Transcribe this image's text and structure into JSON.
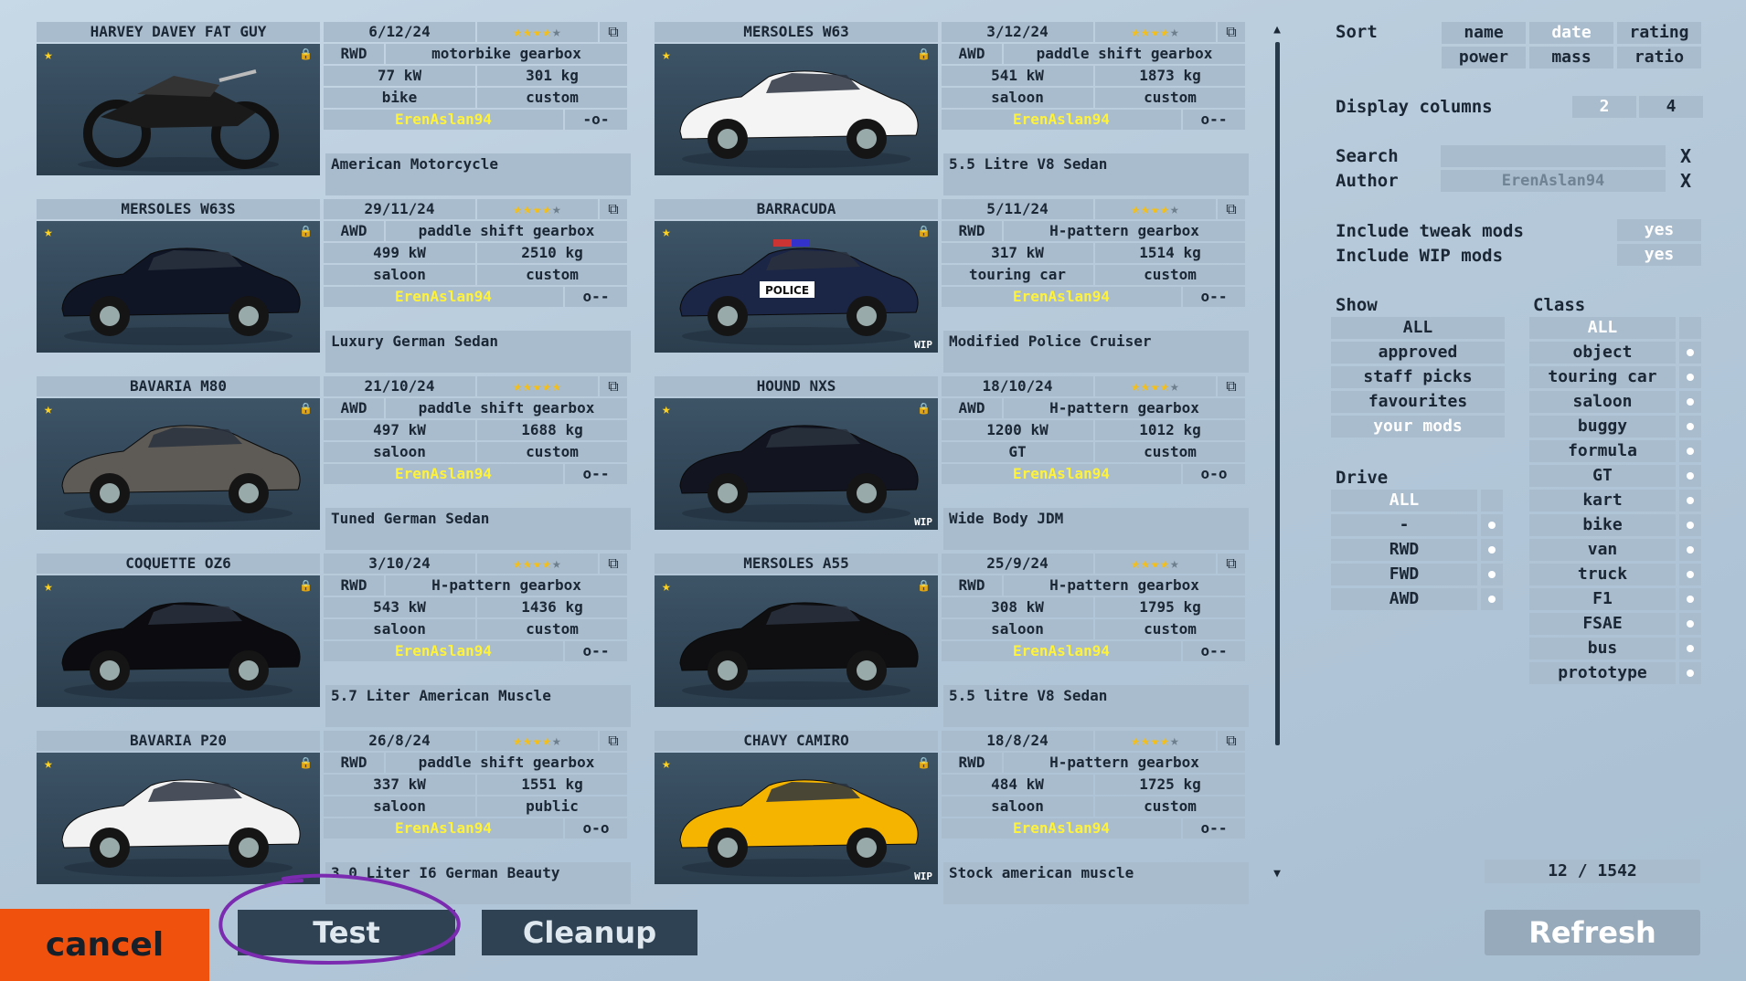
{
  "cards": [
    {
      "name": "HARVEY DAVEY FAT GUY",
      "date": "6/12/24",
      "stars": "★★★★",
      "stars_off": "★",
      "drive": "RWD",
      "gearbox": "motorbike gearbox",
      "power": "77 kW",
      "mass": "301 kg",
      "type": "bike",
      "license": "custom",
      "author": "ErenAslan94",
      "layout": "-o-",
      "desc": "American Motorcycle",
      "wip": ""
    },
    {
      "name": "MERSOLES W63",
      "date": "3/12/24",
      "stars": "★★★★",
      "stars_off": "★",
      "drive": "AWD",
      "gearbox": "paddle shift gearbox",
      "power": "541 kW",
      "mass": "1873 kg",
      "type": "saloon",
      "license": "custom",
      "author": "ErenAslan94",
      "layout": "o--",
      "desc": "5.5 Litre V8 Sedan",
      "wip": ""
    },
    {
      "name": "MERSOLES W63S",
      "date": "29/11/24",
      "stars": "★★★★",
      "stars_off": "★",
      "drive": "AWD",
      "gearbox": "paddle shift gearbox",
      "power": "499 kW",
      "mass": "2510 kg",
      "type": "saloon",
      "license": "custom",
      "author": "ErenAslan94",
      "layout": "o--",
      "desc": "Luxury German Sedan",
      "wip": ""
    },
    {
      "name": "BARRACUDA",
      "date": "5/11/24",
      "stars": "★★★★",
      "stars_off": "★",
      "drive": "RWD",
      "gearbox": "H-pattern gearbox",
      "power": "317 kW",
      "mass": "1514 kg",
      "type": "touring car",
      "license": "custom",
      "author": "ErenAslan94",
      "layout": "o--",
      "desc": "Modified Police Cruiser",
      "wip": "WIP"
    },
    {
      "name": "BAVARIA M80",
      "date": "21/10/24",
      "stars": "★★★★★",
      "stars_off": "",
      "drive": "AWD",
      "gearbox": "paddle shift gearbox",
      "power": "497 kW",
      "mass": "1688 kg",
      "type": "saloon",
      "license": "custom",
      "author": "ErenAslan94",
      "layout": "o--",
      "desc": "Tuned German Sedan",
      "wip": ""
    },
    {
      "name": "HOUND NXS",
      "date": "18/10/24",
      "stars": "★★★★",
      "stars_off": "★",
      "drive": "AWD",
      "gearbox": "H-pattern gearbox",
      "power": "1200 kW",
      "mass": "1012 kg",
      "type": "GT",
      "license": "custom",
      "author": "ErenAslan94",
      "layout": "o-o",
      "desc": "Wide Body JDM",
      "wip": "WIP"
    },
    {
      "name": "COQUETTE OZ6",
      "date": "3/10/24",
      "stars": "★★★★",
      "stars_off": "★",
      "drive": "RWD",
      "gearbox": "H-pattern gearbox",
      "power": "543 kW",
      "mass": "1436 kg",
      "type": "saloon",
      "license": "custom",
      "author": "ErenAslan94",
      "layout": "o--",
      "desc": "5.7 Liter American Muscle",
      "wip": ""
    },
    {
      "name": "MERSOLES A55",
      "date": "25/9/24",
      "stars": "★★★★",
      "stars_off": "★",
      "drive": "RWD",
      "gearbox": "H-pattern gearbox",
      "power": "308 kW",
      "mass": "1795 kg",
      "type": "saloon",
      "license": "custom",
      "author": "ErenAslan94",
      "layout": "o--",
      "desc": "5.5 litre V8 Sedan",
      "wip": ""
    },
    {
      "name": "BAVARIA P20",
      "date": "26/8/24",
      "stars": "★★★★",
      "stars_off": "★",
      "drive": "RWD",
      "gearbox": "paddle shift gearbox",
      "power": "337 kW",
      "mass": "1551 kg",
      "type": "saloon",
      "license": "public",
      "author": "ErenAslan94",
      "layout": "o-o",
      "desc": "3.0 Liter I6 German Beauty",
      "wip": ""
    },
    {
      "name": "CHAVY CAMIRO",
      "date": "18/8/24",
      "stars": "★★★★",
      "stars_off": "★",
      "drive": "RWD",
      "gearbox": "H-pattern gearbox",
      "power": "484 kW",
      "mass": "1725 kg",
      "type": "saloon",
      "license": "custom",
      "author": "ErenAslan94",
      "layout": "o--",
      "desc": "Stock american muscle",
      "wip": "WIP"
    }
  ],
  "sort": {
    "label": "Sort",
    "options": [
      "name",
      "date",
      "rating",
      "power",
      "mass",
      "ratio"
    ],
    "selected": "date"
  },
  "display_columns": {
    "label": "Display columns",
    "options": [
      "2",
      "4"
    ],
    "selected": "4"
  },
  "search": {
    "label": "Search",
    "value": "",
    "clear": "X"
  },
  "author": {
    "label": "Author",
    "value": "ErenAslan94",
    "clear": "X"
  },
  "include_tweak": {
    "label": "Include tweak mods",
    "value": "yes"
  },
  "include_wip": {
    "label": "Include WIP mods",
    "value": "yes"
  },
  "show": {
    "label": "Show",
    "options": [
      "ALL",
      "approved",
      "staff picks",
      "favourites",
      "your mods"
    ],
    "selected": "your mods"
  },
  "drive": {
    "label": "Drive",
    "options": [
      "ALL",
      "-",
      "RWD",
      "FWD",
      "AWD"
    ],
    "selected": "ALL"
  },
  "class": {
    "label": "Class",
    "options": [
      "ALL",
      "object",
      "touring car",
      "saloon",
      "buggy",
      "formula",
      "GT",
      "kart",
      "bike",
      "van",
      "truck",
      "F1",
      "FSAE",
      "bus",
      "prototype"
    ],
    "selected": "ALL"
  },
  "counter": "12 / 1542",
  "buttons": {
    "cancel": "cancel",
    "test": "Test",
    "cleanup": "Cleanup",
    "refresh": "Refresh"
  },
  "colors": {
    "cancel_bg": "#f0520e",
    "annotation": "#7a2bb0",
    "author_text": "#fff23a",
    "star": "#f3bf18"
  }
}
